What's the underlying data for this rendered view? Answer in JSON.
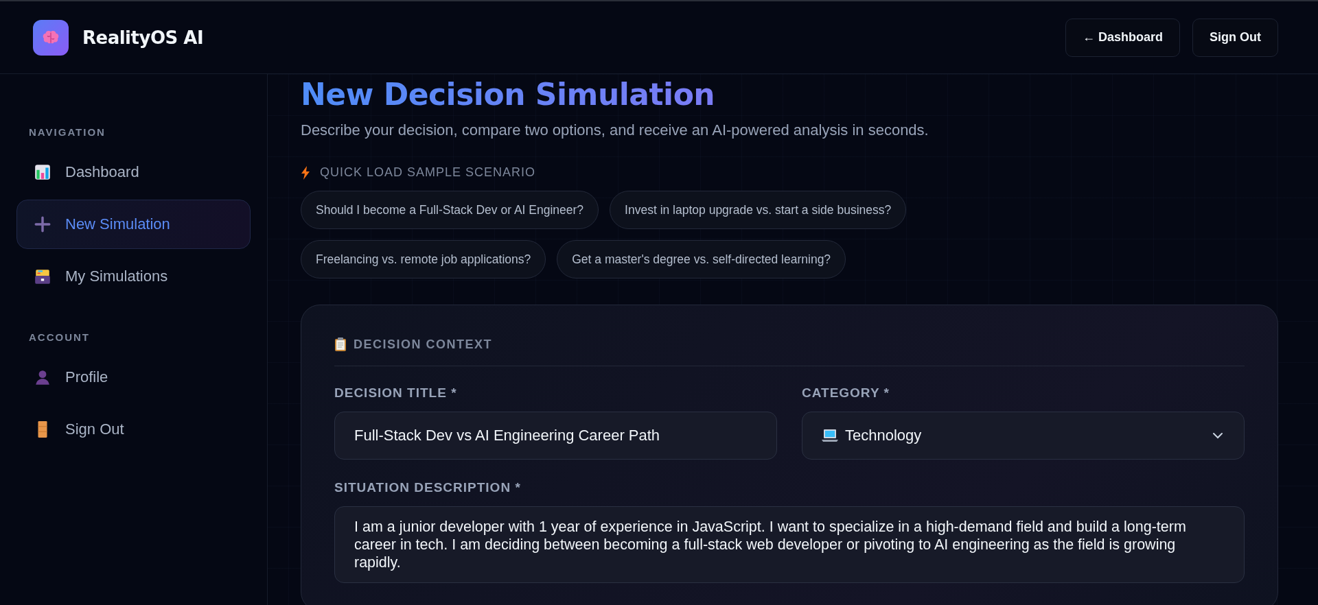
{
  "app": {
    "name": "RealityOS AI"
  },
  "header_buttons": [
    {
      "label": "← Dashboard"
    },
    {
      "label": "Sign Out"
    }
  ],
  "sidebar": {
    "sections": [
      {
        "title": "NAVIGATION",
        "items": [
          {
            "label": "Dashboard",
            "selected": false
          },
          {
            "label": "New Simulation",
            "selected": true
          },
          {
            "label": "My Simulations",
            "selected": false
          }
        ]
      },
      {
        "title": "ACCOUNT",
        "items": [
          {
            "label": "Profile",
            "selected": false
          },
          {
            "label": "Sign Out",
            "selected": false
          }
        ]
      }
    ]
  },
  "page": {
    "title": "New Decision Simulation",
    "subtitle": "Describe your decision, compare two options, and receive an AI-powered analysis in seconds.",
    "quick_load": {
      "label": "QUICK LOAD SAMPLE SCENARIO",
      "scenarios": [
        "Should I become a Full-Stack Dev or AI Engineer?",
        "Invest in laptop upgrade vs. start a side business?",
        "Freelancing vs. remote job applications?",
        "Get a master's degree vs. self-directed learning?"
      ]
    }
  },
  "form": {
    "section_title": "DECISION CONTEXT",
    "decision_title": {
      "label": "DECISION TITLE *",
      "value": "Full-Stack Dev vs AI Engineering Career Path"
    },
    "category": {
      "label": "CATEGORY *",
      "value": "Technology"
    },
    "situation": {
      "label": "SITUATION DESCRIPTION *",
      "value": "I am a junior developer with 1 year of experience in JavaScript. I want to specialize in a high-demand field and build a long-term career in tech. I am deciding between becoming a full-stack web developer or pivoting to AI engineering as the field is growing rapidly."
    }
  }
}
